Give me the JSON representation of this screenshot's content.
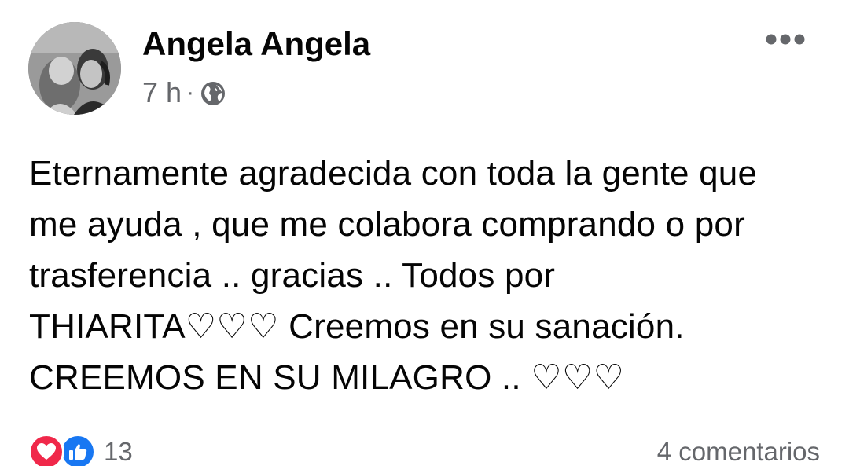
{
  "post": {
    "author_name": "Angela Angela",
    "timestamp": "7 h",
    "separator": "·",
    "privacy_icon": "globe-icon",
    "more_icon": "more-horizontal-icon",
    "text": "Eternamente agradecida con toda la gente que\nme ayuda , que me colabora comprando o por\ntrasferencia .. gracias .. Todos por\nTHIARITA♡♡♡ Creemos en su sanación.\nCREEMOS EN SU MILAGRO .. ♡♡♡"
  },
  "footer": {
    "reaction_icons": [
      "love-reaction-icon",
      "like-reaction-icon"
    ],
    "reaction_count": "13",
    "comments_label": "4 comentarios"
  },
  "colors": {
    "text_primary": "#050505",
    "text_secondary": "#65676b",
    "love": "#f0284a",
    "like": "#1877f2"
  }
}
